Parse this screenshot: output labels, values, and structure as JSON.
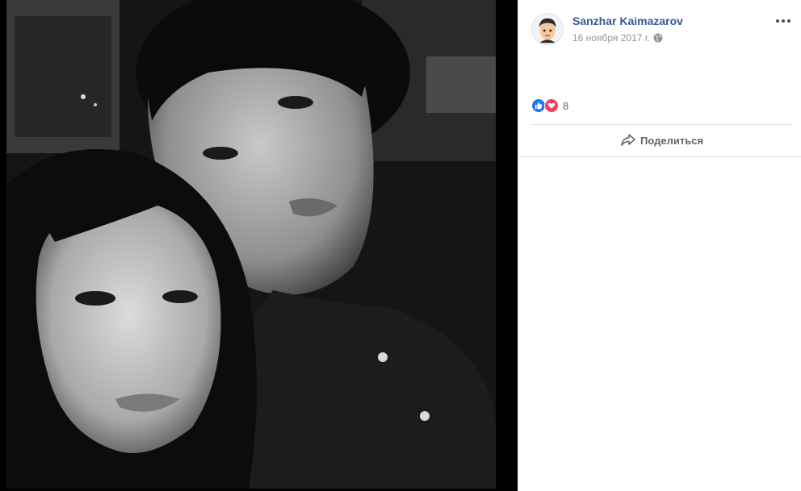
{
  "post": {
    "author_name": "Sanzhar Kaimazarov",
    "date": "16 ноября 2017 г.",
    "privacy_icon": "globe-icon"
  },
  "reactions": {
    "types": [
      "like",
      "love"
    ],
    "count": "8"
  },
  "actions": {
    "share_label": "Поделиться"
  },
  "colors": {
    "author_link": "#365899",
    "like": "#2078f4",
    "love": "#f33e58",
    "divider": "#dddfe2"
  }
}
